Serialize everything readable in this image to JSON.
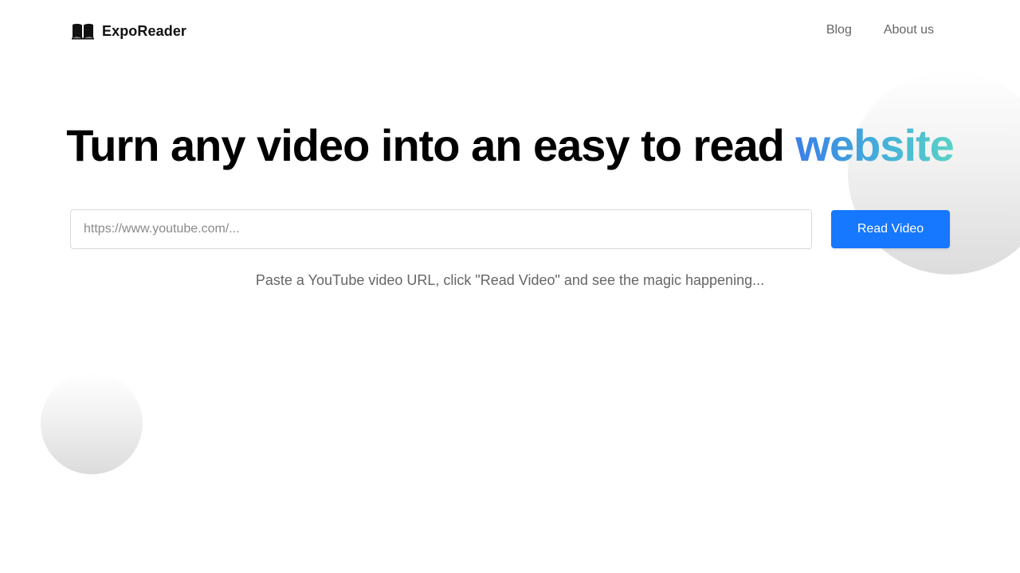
{
  "brand": {
    "name": "ExpoReader",
    "icon": "open-book-icon"
  },
  "nav": {
    "items": [
      {
        "label": "Blog"
      },
      {
        "label": "About us"
      }
    ]
  },
  "hero": {
    "title_main": "Turn any video into an easy to read ",
    "title_accent": "website",
    "accent_gradient": [
      "#3b7fe8",
      "#45b0d8",
      "#5ad2c6"
    ]
  },
  "form": {
    "url_placeholder": "https://www.youtube.com/...",
    "url_value": "",
    "submit_label": "Read Video",
    "submit_color": "#1677ff"
  },
  "hint": {
    "text": "Paste a YouTube video URL, click \"Read Video\" and see the magic happening..."
  }
}
